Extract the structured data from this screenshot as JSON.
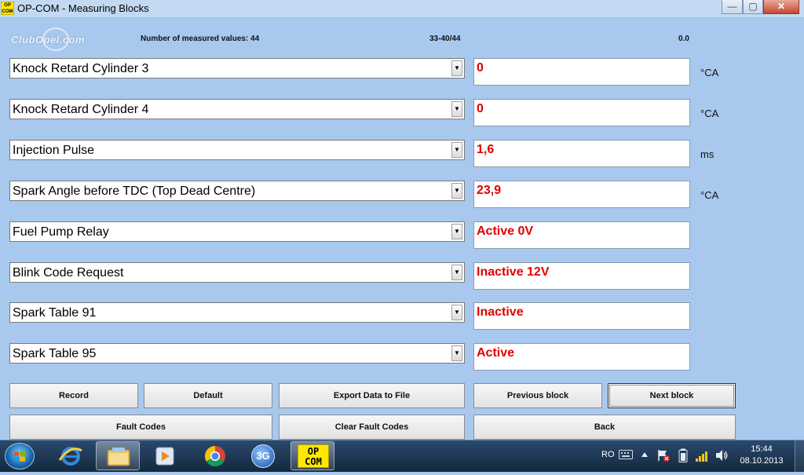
{
  "window": {
    "app_icon_text": "OP\nCOM",
    "title": "OP-COM - Measuring Blocks",
    "minimize": "—",
    "maximize": "▢",
    "close": "✕"
  },
  "header": {
    "logo": "ClubOpel.com",
    "count_label": "Number of measured values: 44",
    "range": "33-40/44",
    "time_value": "0.0"
  },
  "measurements": [
    {
      "name": "Knock Retard Cylinder 3",
      "value": "0",
      "unit": "°CA"
    },
    {
      "name": "Knock Retard Cylinder 4",
      "value": "0",
      "unit": "°CA"
    },
    {
      "name": "Injection Pulse",
      "value": "1,6",
      "unit": "ms"
    },
    {
      "name": "Spark Angle before TDC (Top Dead Centre)",
      "value": "23,9",
      "unit": "°CA"
    },
    {
      "name": "Fuel Pump Relay",
      "value": "Active 0V",
      "unit": ""
    },
    {
      "name": "Blink Code Request",
      "value": "Inactive 12V",
      "unit": ""
    },
    {
      "name": "Spark Table 91",
      "value": "Inactive",
      "unit": ""
    },
    {
      "name": "Spark Table 95",
      "value": "Active",
      "unit": ""
    }
  ],
  "buttons": {
    "record": "Record",
    "default": "Default",
    "export": "Export Data to File",
    "previous": "Previous block",
    "next": "Next block",
    "fault_codes": "Fault Codes",
    "clear_fault_codes": "Clear Fault Codes",
    "back": "Back"
  },
  "taskbar": {
    "items": [
      "ie-icon",
      "explorer-icon",
      "media-player-icon",
      "chrome-icon",
      "3g-modem-icon",
      "opcom-icon"
    ],
    "threeg_text": "3G",
    "opcom_text": "OP\nCOM",
    "language": "RO",
    "time": "15:44",
    "date": "08.10.2013"
  },
  "colors": {
    "client_background": "#a8c8ee",
    "value_text": "#e00000",
    "taskbar": "#1e3858"
  }
}
